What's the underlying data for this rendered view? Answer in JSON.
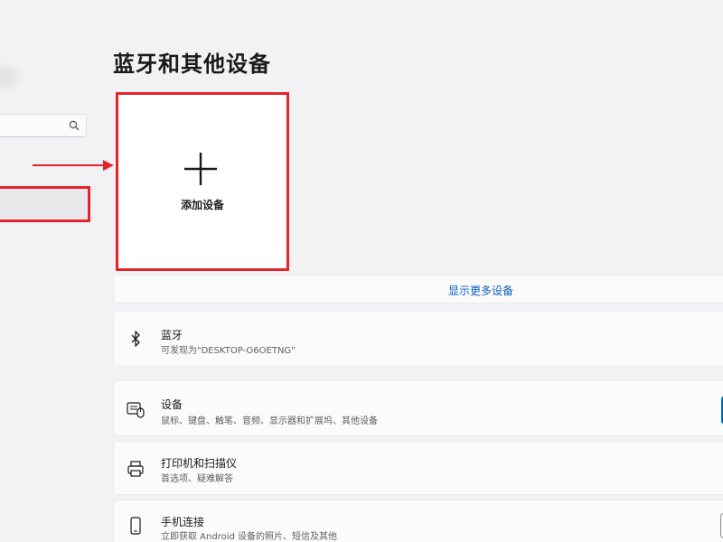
{
  "page": {
    "title": "蓝牙和其他设备"
  },
  "search": {
    "value": "",
    "icon": "search-icon"
  },
  "add_device": {
    "label": "添加设备",
    "icon": "plus-icon"
  },
  "show_more": {
    "label": "显示更多设备"
  },
  "cards": {
    "bluetooth": {
      "title": "蓝牙",
      "subtitle": "可发现为\"DESKTOP-O6OETNG\"",
      "icon": "bluetooth-icon"
    },
    "devices": {
      "title": "设备",
      "subtitle": "鼠标、键盘、触笔、音频、显示器和扩展坞、其他设备",
      "icon": "devices-icon"
    },
    "printers": {
      "title": "打印机和扫描仪",
      "subtitle": "首选项、疑难解答",
      "icon": "printer-icon"
    },
    "phone": {
      "title": "手机连接",
      "subtitle": "立即获取 Android 设备的照片、短信及其他",
      "icon": "phone-icon"
    }
  },
  "colors": {
    "accent": "#0067c0",
    "link": "#0a5fbd",
    "annotation": "#e5232b",
    "background": "#f2f2f4",
    "card": "#fbfbfb"
  }
}
